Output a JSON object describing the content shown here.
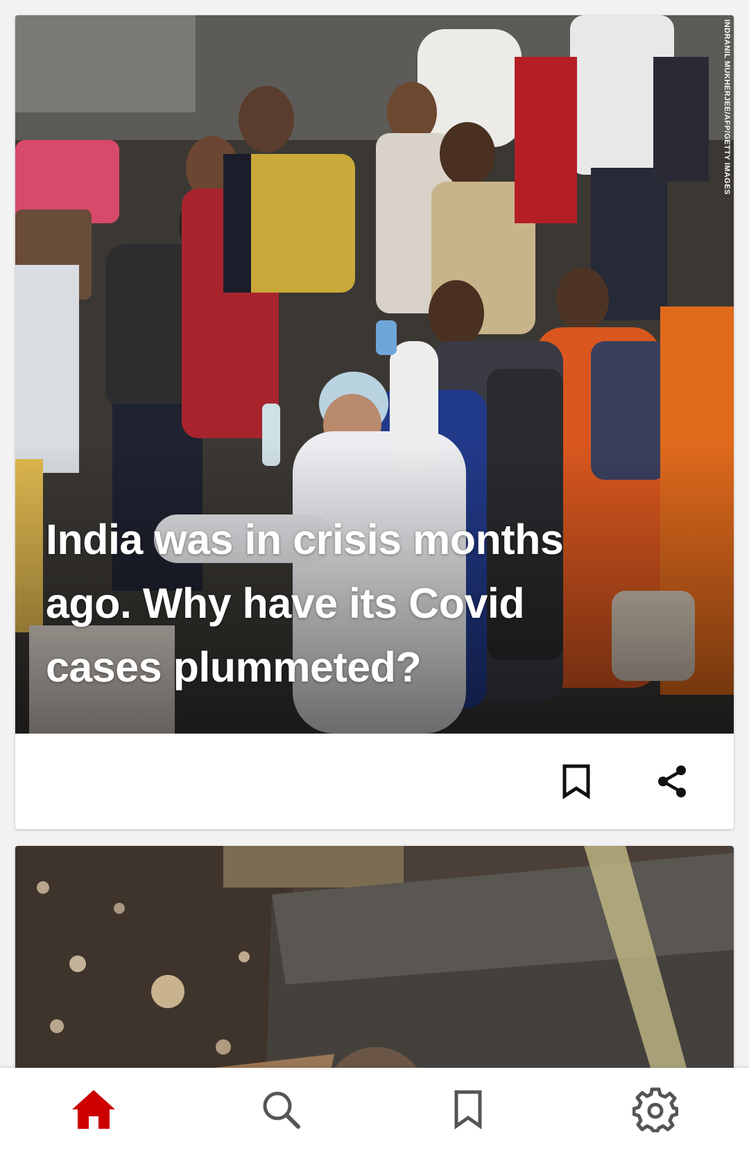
{
  "accent_color": "#cc0000",
  "feed": {
    "cards": [
      {
        "photo_credit": "INDRANIL MUKHERJEE/AFP/GETTY IMAGES",
        "headline": "India was in crisis months ago. Why have its Covid cases plummeted?",
        "actions": [
          {
            "icon": "bookmark-icon"
          },
          {
            "icon": "share-icon"
          }
        ]
      },
      {
        "image": "rat-under-trap-photo"
      }
    ]
  },
  "bottom_nav": {
    "items": [
      {
        "icon": "home-icon",
        "active": true
      },
      {
        "icon": "search-icon",
        "active": false
      },
      {
        "icon": "bookmark-icon",
        "active": false
      },
      {
        "icon": "gear-icon",
        "active": false
      }
    ]
  }
}
